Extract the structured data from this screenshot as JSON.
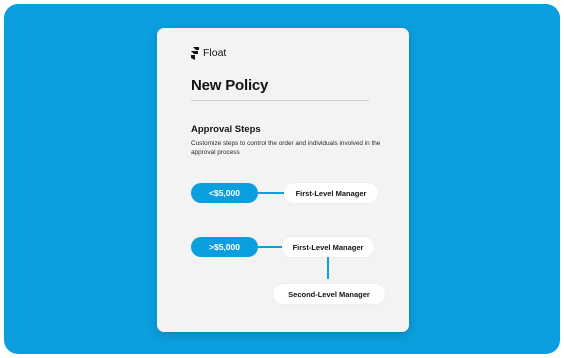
{
  "brand": {
    "name": "Float",
    "logo_icon": "float-logo-icon"
  },
  "policy": {
    "title": "New Policy",
    "section_title": "Approval Steps",
    "section_description": "Customize steps to control the order and individuals involved in the approval process"
  },
  "rules": [
    {
      "threshold": "<$5,000",
      "approvers": [
        "First-Level Manager"
      ]
    },
    {
      "threshold": ">$5,000",
      "approvers": [
        "First-Level Manager",
        "Second-Level Manager"
      ]
    }
  ],
  "colors": {
    "accent": "#0b9fdf",
    "card": "#f3f3f3",
    "text": "#141414"
  }
}
